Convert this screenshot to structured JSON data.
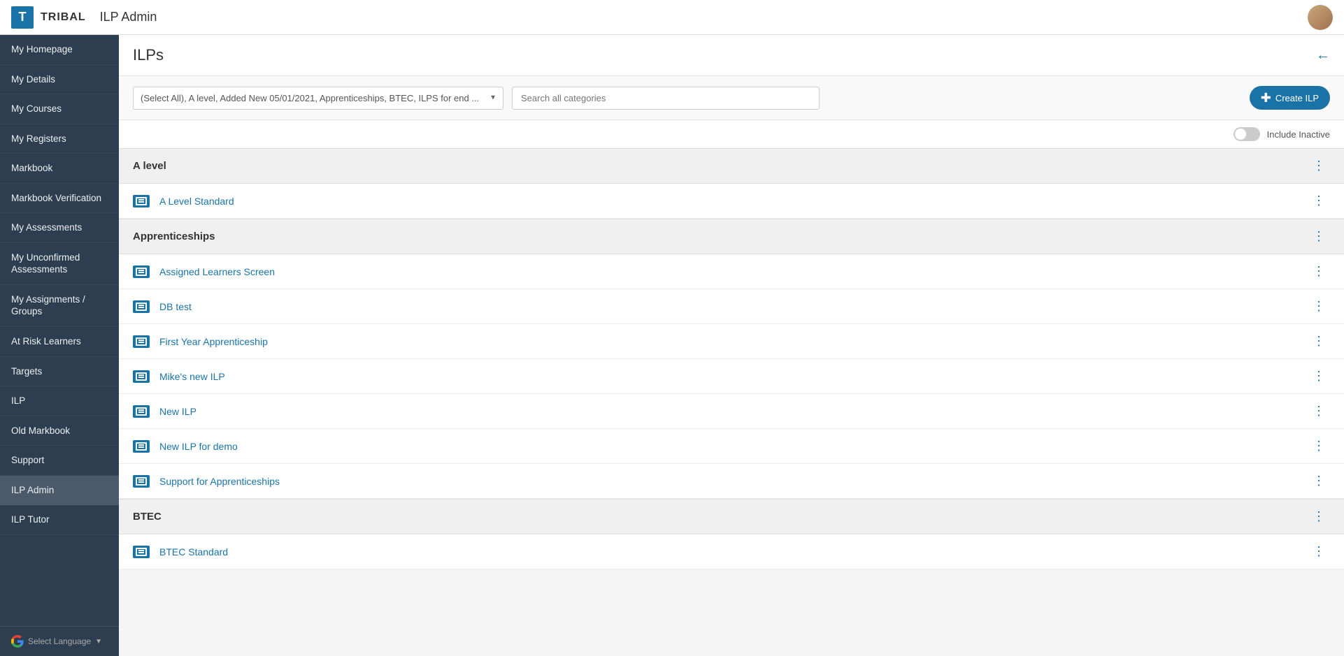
{
  "header": {
    "logo_letter": "T",
    "logo_name": "TRIBAL",
    "app_title": "ILP Admin"
  },
  "sidebar": {
    "items": [
      {
        "id": "my-homepage",
        "label": "My Homepage",
        "active": false
      },
      {
        "id": "my-details",
        "label": "My Details",
        "active": false
      },
      {
        "id": "my-courses",
        "label": "My Courses",
        "active": false
      },
      {
        "id": "my-registers",
        "label": "My Registers",
        "active": false
      },
      {
        "id": "markbook",
        "label": "Markbook",
        "active": false
      },
      {
        "id": "markbook-verification",
        "label": "Markbook Verification",
        "active": false
      },
      {
        "id": "my-assessments",
        "label": "My Assessments",
        "active": false
      },
      {
        "id": "my-unconfirmed-assessments",
        "label": "My Unconfirmed Assessments",
        "active": false
      },
      {
        "id": "my-assignments-groups",
        "label": "My Assignments / Groups",
        "active": false
      },
      {
        "id": "at-risk-learners",
        "label": "At Risk Learners",
        "active": false
      },
      {
        "id": "targets",
        "label": "Targets",
        "active": false
      },
      {
        "id": "ilp",
        "label": "ILP",
        "active": false
      },
      {
        "id": "old-markbook",
        "label": "Old Markbook",
        "active": false
      },
      {
        "id": "support",
        "label": "Support",
        "active": false
      },
      {
        "id": "ilp-admin",
        "label": "ILP Admin",
        "active": true
      },
      {
        "id": "ilp-tutor",
        "label": "ILP Tutor",
        "active": false
      }
    ],
    "footer": {
      "select_language": "Select Language"
    }
  },
  "main": {
    "title": "ILPs",
    "filter": {
      "dropdown_value": "(Select All), A level, Added New 05/01/2021, Apprenticeships, BTEC, ILPS for end ...",
      "search_placeholder": "Search all categories"
    },
    "create_button": "Create ILP",
    "include_inactive_label": "Include Inactive",
    "categories": [
      {
        "name": "A level",
        "items": [
          {
            "id": "a-level-standard",
            "label": "A Level Standard"
          }
        ]
      },
      {
        "name": "Apprenticeships",
        "items": [
          {
            "id": "assigned-learners-screen",
            "label": "Assigned Learners Screen"
          },
          {
            "id": "db-test",
            "label": "DB test"
          },
          {
            "id": "first-year-apprenticeship",
            "label": "First Year Apprenticeship"
          },
          {
            "id": "mikes-new-ilp",
            "label": "Mike's new ILP"
          },
          {
            "id": "new-ilp",
            "label": "New ILP"
          },
          {
            "id": "new-ilp-for-demo",
            "label": "New ILP for demo"
          },
          {
            "id": "support-for-apprenticeships",
            "label": "Support for Apprenticeships"
          }
        ]
      },
      {
        "name": "BTEC",
        "items": [
          {
            "id": "btec-standard",
            "label": "BTEC Standard"
          }
        ]
      }
    ]
  }
}
